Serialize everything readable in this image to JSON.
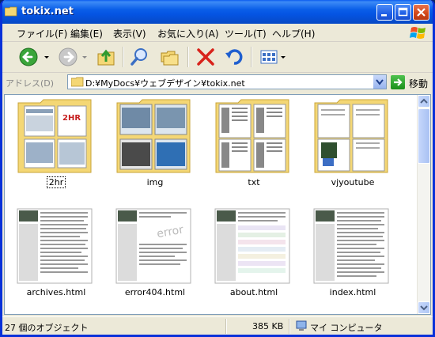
{
  "window": {
    "title": "tokix.net"
  },
  "menu": [
    "ファイル(F)",
    "編集(E)",
    "表示(V)",
    "お気に入り(A)",
    "ツール(T)",
    "ヘルプ(H)"
  ],
  "address": {
    "label": "アドレス(D)",
    "path": "D:¥MyDocs¥ウェブデザイン¥tokix.net",
    "go_label": "移動"
  },
  "items": [
    {
      "name": "2hr",
      "kind": "folder"
    },
    {
      "name": "img",
      "kind": "folder"
    },
    {
      "name": "txt",
      "kind": "folder"
    },
    {
      "name": "vjyoutube",
      "kind": "folder"
    },
    {
      "name": "archives.html",
      "kind": "html"
    },
    {
      "name": "error404.html",
      "kind": "html"
    },
    {
      "name": "about.html",
      "kind": "html"
    },
    {
      "name": "index.html",
      "kind": "html"
    }
  ],
  "status": {
    "objects": "27 個のオブジェクト",
    "size": "385 KB",
    "location": "マイ コンピュータ"
  },
  "colors": {
    "title_blue": "#0554e3",
    "folder_yellow": "#f4d775",
    "content_bg": "#ffffff"
  }
}
